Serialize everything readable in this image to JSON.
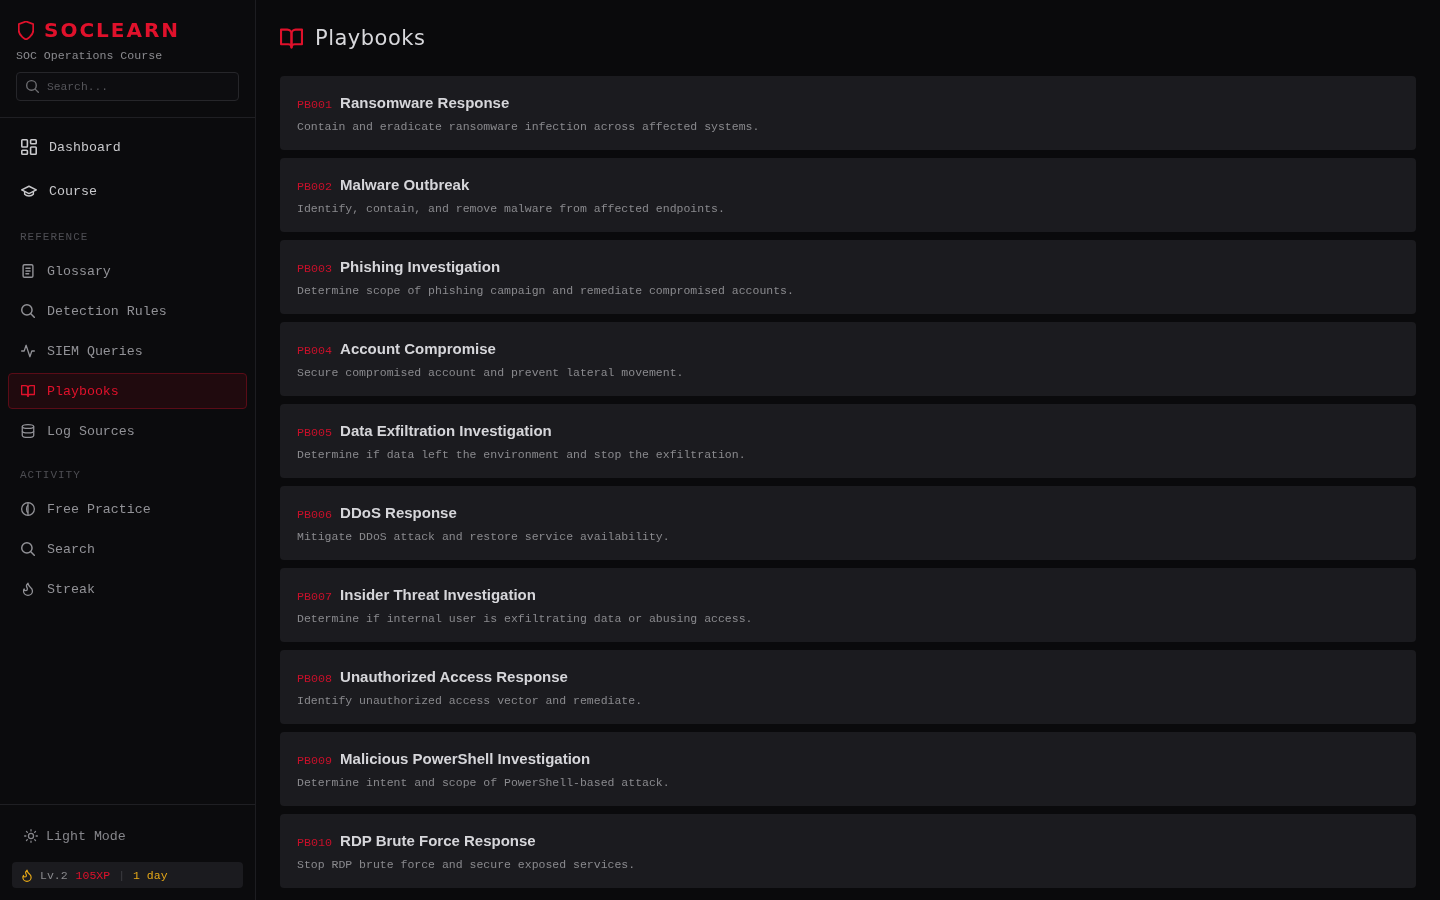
{
  "brand": {
    "name": "SOCLEARN",
    "subtitle": "SOC Operations Course"
  },
  "search": {
    "placeholder": "Search..."
  },
  "nav": [
    {
      "items": [
        {
          "label": "Dashboard",
          "selected": false
        },
        {
          "label": "Course",
          "selected": false
        }
      ]
    },
    {
      "label": "REFERENCE",
      "items": [
        {
          "label": "Glossary",
          "selected": false
        },
        {
          "label": "Detection Rules",
          "selected": false
        },
        {
          "label": "SIEM Queries",
          "selected": false
        },
        {
          "label": "Playbooks",
          "selected": true
        },
        {
          "label": "Log Sources",
          "selected": false
        }
      ]
    },
    {
      "label": "ACTIVITY",
      "items": [
        {
          "label": "Free Practice",
          "selected": false
        },
        {
          "label": "Search",
          "selected": false
        },
        {
          "label": "Streak",
          "selected": false
        }
      ]
    }
  ],
  "theme_toggle": {
    "label": "Light Mode"
  },
  "stats": {
    "level": "Lv.2",
    "xp": "105XP",
    "separator": "|",
    "streak": "1 day"
  },
  "page": {
    "title": "Playbooks"
  },
  "playbooks": [
    {
      "code": "PB001",
      "title": "Ransomware Response",
      "description": "Contain and eradicate ransomware infection across affected systems."
    },
    {
      "code": "PB002",
      "title": "Malware Outbreak",
      "description": "Identify, contain, and remove malware from affected endpoints."
    },
    {
      "code": "PB003",
      "title": "Phishing Investigation",
      "description": "Determine scope of phishing campaign and remediate compromised accounts."
    },
    {
      "code": "PB004",
      "title": "Account Compromise",
      "description": "Secure compromised account and prevent lateral movement."
    },
    {
      "code": "PB005",
      "title": "Data Exfiltration Investigation",
      "description": "Determine if data left the environment and stop the exfiltration."
    },
    {
      "code": "PB006",
      "title": "DDoS Response",
      "description": "Mitigate DDoS attack and restore service availability."
    },
    {
      "code": "PB007",
      "title": "Insider Threat Investigation",
      "description": "Determine if internal user is exfiltrating data or abusing access."
    },
    {
      "code": "PB008",
      "title": "Unauthorized Access Response",
      "description": "Identify unauthorized access vector and remediate."
    },
    {
      "code": "PB009",
      "title": "Malicious PowerShell Investigation",
      "description": "Determine intent and scope of PowerShell-based attack."
    },
    {
      "code": "PB010",
      "title": "RDP Brute Force Response",
      "description": "Stop RDP brute force and secure exposed services."
    }
  ]
}
